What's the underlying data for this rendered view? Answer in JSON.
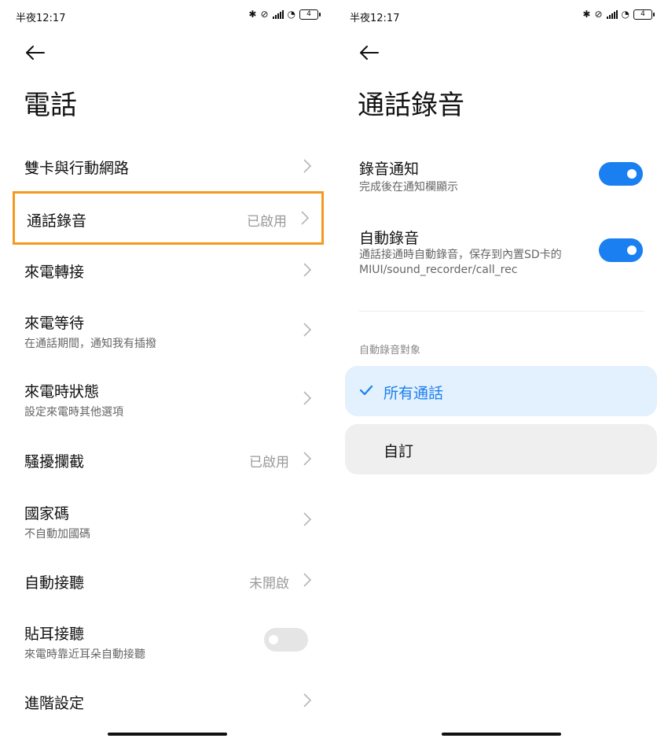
{
  "status_bar": {
    "time": "半夜12:17",
    "battery": "4"
  },
  "left": {
    "title": "電話",
    "items": [
      {
        "label": "雙卡與行動網路",
        "value": "",
        "sub": ""
      },
      {
        "label": "通話錄音",
        "value": "已啟用",
        "sub": ""
      },
      {
        "label": "來電轉接",
        "value": "",
        "sub": ""
      },
      {
        "label": "來電等待",
        "value": "",
        "sub": "在通話期間，通知我有插撥"
      },
      {
        "label": "來電時狀態",
        "value": "",
        "sub": "設定來電時其他選項"
      },
      {
        "label": "騷擾攔截",
        "value": "已啟用",
        "sub": ""
      },
      {
        "label": "國家碼",
        "value": "",
        "sub": "不自動加國碼"
      },
      {
        "label": "自動接聽",
        "value": "未開啟",
        "sub": ""
      },
      {
        "label": "貼耳接聽",
        "value": "",
        "sub": "來電時靠近耳朵自動接聽",
        "toggle": "off"
      },
      {
        "label": "進階設定",
        "value": "",
        "sub": ""
      }
    ]
  },
  "right": {
    "title": "通話錄音",
    "recording_notice": {
      "label": "錄音通知",
      "sub": "完成後在通知欄顯示",
      "toggle": "on"
    },
    "auto_record": {
      "label": "自動錄音",
      "sub_line1": "通話接通時自動錄音，保存到內置SD卡的",
      "sub_line2": "MIUI/sound_recorder/call_rec",
      "toggle": "on"
    },
    "section_title": "自動錄音對象",
    "options": [
      {
        "label": "所有通話",
        "selected": true
      },
      {
        "label": "自訂",
        "selected": false
      }
    ]
  },
  "colors": {
    "accent": "#1a7ff0",
    "highlight": "#f39a1e"
  }
}
